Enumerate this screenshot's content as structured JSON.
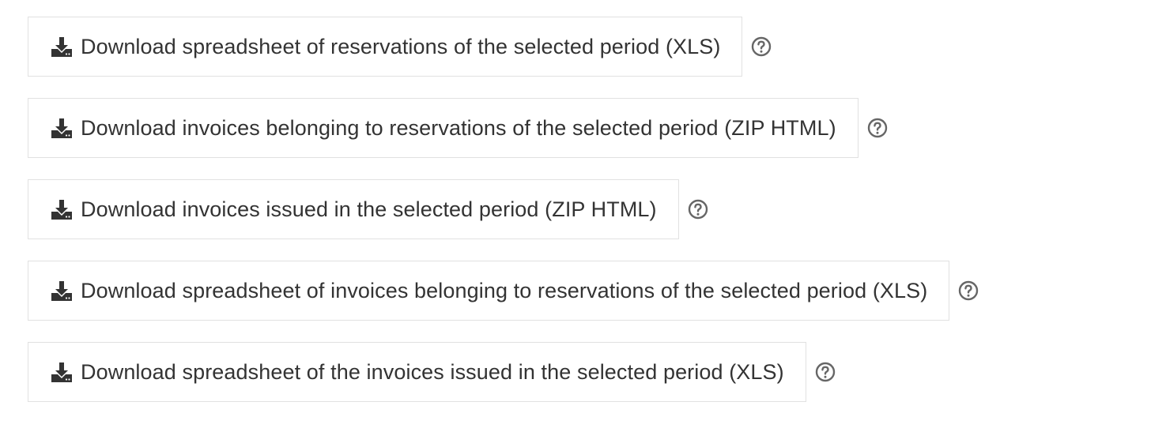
{
  "downloads": [
    {
      "label": "Download spreadsheet of reservations of the selected period (XLS)",
      "icon": "download-icon",
      "help_icon": "help-icon"
    },
    {
      "label": "Download invoices belonging to reservations of the selected period (ZIP HTML)",
      "icon": "download-icon",
      "help_icon": "help-icon"
    },
    {
      "label": "Download invoices issued in the selected period (ZIP HTML)",
      "icon": "download-icon",
      "help_icon": "help-icon"
    },
    {
      "label": "Download spreadsheet of invoices belonging to reservations of the selected period (XLS)",
      "icon": "download-icon",
      "help_icon": "help-icon"
    },
    {
      "label": "Download spreadsheet of the invoices issued in the selected period (XLS)",
      "icon": "download-icon",
      "help_icon": "help-icon"
    }
  ],
  "colors": {
    "text": "#333333",
    "border": "#e1e1e1",
    "help_icon": "#666666"
  }
}
